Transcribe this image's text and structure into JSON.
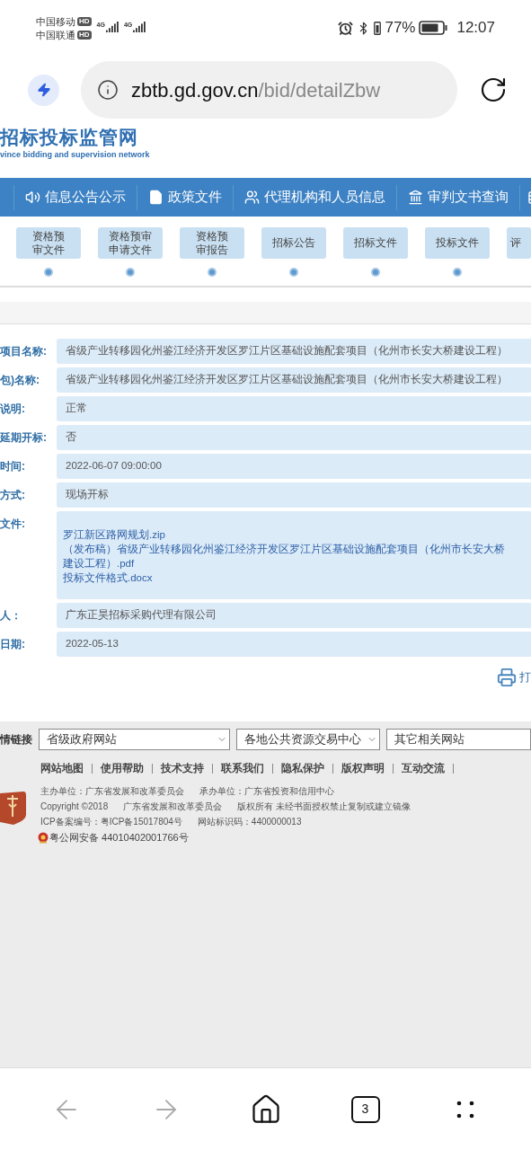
{
  "status_bar": {
    "carriers": [
      {
        "name": "中国移动",
        "badge": "HD",
        "network": "4G"
      },
      {
        "name": "中国联通",
        "badge": "HD",
        "network": "4G"
      }
    ],
    "battery_percent": "77%",
    "time": "12:07"
  },
  "address_bar": {
    "host": "zbtb.gd.gov.cn",
    "path": "/bid/detailZbw"
  },
  "site_header": {
    "title": "招标投标监管网",
    "subtitle": "vince bidding and supervision network"
  },
  "nav": {
    "items": [
      "信息公告公示",
      "政策文件",
      "代理机构和人员信息",
      "审判文书查询"
    ]
  },
  "steps": [
    {
      "lines": [
        "资格预",
        "审文件"
      ]
    },
    {
      "lines": [
        "资格预审",
        "申请文件"
      ]
    },
    {
      "lines": [
        "资格预",
        "审报告"
      ]
    },
    {
      "lines": [
        "招标公告"
      ]
    },
    {
      "lines": [
        "招标文件"
      ]
    },
    {
      "lines": [
        "投标文件"
      ]
    },
    {
      "lines": [
        "评"
      ]
    }
  ],
  "details": [
    {
      "kind": "text",
      "label": "项目名称:",
      "value": "省级产业转移园化州鉴江经济开发区罗江片区基础设施配套项目（化州市长安大桥建设工程）"
    },
    {
      "kind": "text",
      "label": "包)名称:",
      "value": "省级产业转移园化州鉴江经济开发区罗江片区基础设施配套项目（化州市长安大桥建设工程）"
    },
    {
      "kind": "text",
      "label": "说明:",
      "value": "正常"
    },
    {
      "kind": "text",
      "label": "延期开标:",
      "value": "否"
    },
    {
      "kind": "text",
      "label": "时间:",
      "value": "2022-06-07 09:00:00"
    },
    {
      "kind": "text",
      "label": "方式:",
      "value": "现场开标"
    },
    {
      "kind": "files",
      "label": "文件:",
      "files": [
        "罗江新区路网规划.zip",
        "（发布稿）省级产业转移园化州鉴江经济开发区罗江片区基础设施配套项目（化州市长安大桥建设工程）.pdf",
        "投标文件格式.docx"
      ]
    },
    {
      "kind": "text",
      "label": "人：",
      "value": "广东正昊招标采购代理有限公司"
    },
    {
      "kind": "text",
      "label": "日期:",
      "value": "2022-05-13"
    }
  ],
  "print_label": "打",
  "footer": {
    "links_label": "情链接",
    "selects": [
      "省级政府网站",
      "各地公共资源交易中心",
      "其它相关网站"
    ],
    "links": [
      "网站地图",
      "使用帮助",
      "技术支持",
      "联系我们",
      "隐私保护",
      "版权声明",
      "互动交流"
    ],
    "info_lines": [
      [
        "主办单位：广东省发展和改革委员会",
        "承办单位：广东省投资和信用中心"
      ],
      [
        "Copyright ©2018",
        "广东省发展和改革委员会",
        "版权所有 未经书面授权禁止复制或建立镜像"
      ],
      [
        "ICP备案编号：粤ICP备15017804号",
        "网站标识码：4400000013"
      ]
    ],
    "police_record": "粤公网安备 44010402001766号"
  },
  "bottom_bar": {
    "buttons": [
      {
        "kind": "back",
        "disabled": true
      },
      {
        "kind": "forward",
        "disabled": true
      },
      {
        "kind": "home",
        "disabled": false
      },
      {
        "kind": "tabs",
        "disabled": false,
        "count": "3"
      },
      {
        "kind": "more",
        "disabled": false
      }
    ]
  }
}
